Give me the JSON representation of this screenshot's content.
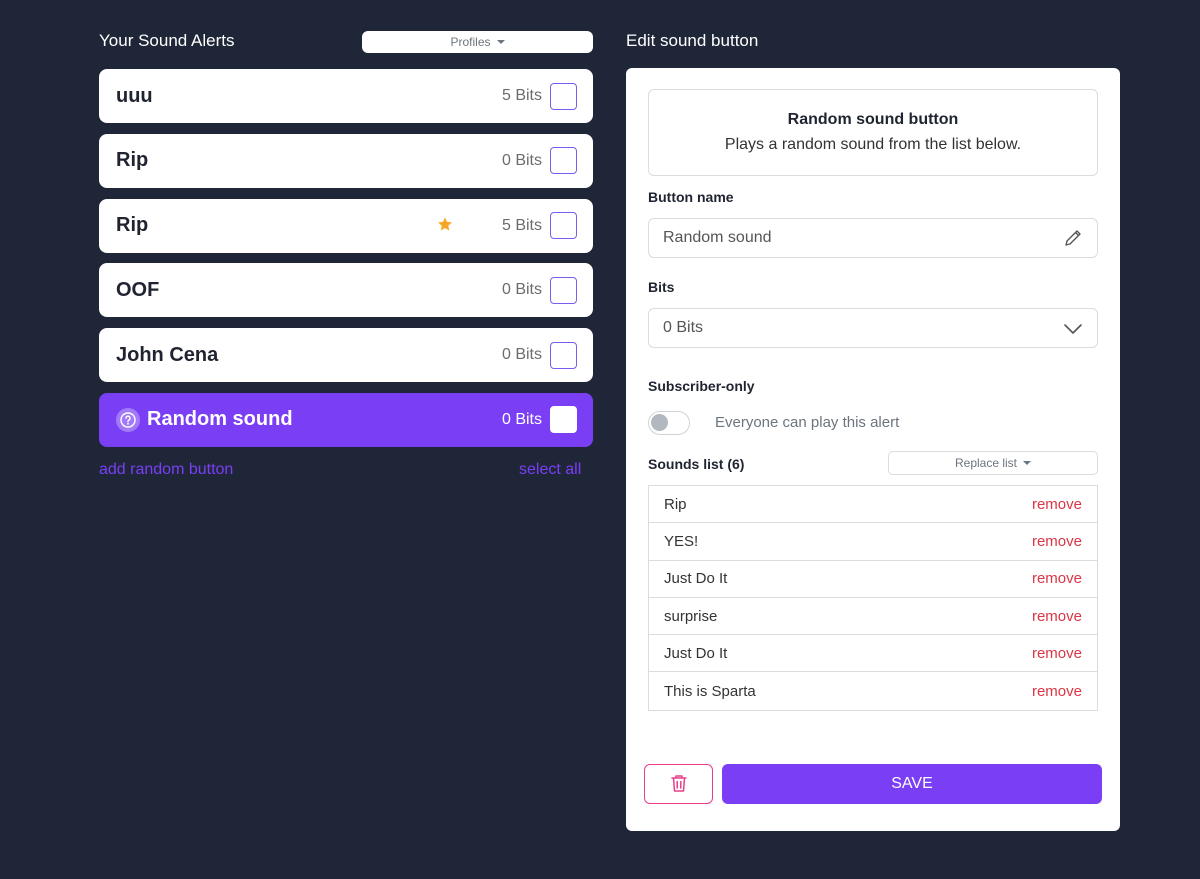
{
  "left": {
    "title": "Your Sound Alerts",
    "profiles_label": "Profiles",
    "alerts": [
      {
        "name": "uuu",
        "bits": "5 Bits",
        "starred": false,
        "active": false
      },
      {
        "name": "Rip",
        "bits": "0 Bits",
        "starred": false,
        "active": false
      },
      {
        "name": "Rip",
        "bits": "5 Bits",
        "starred": true,
        "active": false
      },
      {
        "name": "OOF",
        "bits": "0 Bits",
        "starred": false,
        "active": false
      },
      {
        "name": "John Cena",
        "bits": "0 Bits",
        "starred": false,
        "active": false
      },
      {
        "name": "Random sound",
        "bits": "0 Bits",
        "starred": false,
        "active": true
      }
    ],
    "add_random_label": "add random button",
    "select_all_label": "select all"
  },
  "right": {
    "title": "Edit sound button",
    "info_title": "Random sound button",
    "info_subtitle": "Plays a random sound from the list below.",
    "button_name_label": "Button name",
    "button_name_value": "Random sound",
    "bits_label": "Bits",
    "bits_value": "0 Bits",
    "subscriber_label": "Subscriber-only",
    "subscriber_toggle_text": "Everyone can play this alert",
    "subscriber_only": false,
    "sounds_list_label": "Sounds list (6)",
    "replace_list_label": "Replace list",
    "sounds": [
      {
        "name": "Rip",
        "action": "remove"
      },
      {
        "name": "YES!",
        "action": "remove"
      },
      {
        "name": "Just Do It",
        "action": "remove"
      },
      {
        "name": "surprise",
        "action": "remove"
      },
      {
        "name": "Just Do It",
        "action": "remove"
      },
      {
        "name": "This is Sparta",
        "action": "remove"
      }
    ],
    "save_label": "SAVE"
  },
  "colors": {
    "background": "#1e2638",
    "accent": "#7a3ff5",
    "remove": "#dc3545",
    "star": "#f5a623",
    "delete_border": "#e83e8c"
  },
  "icons": {
    "profiles_caret": "caret-down-icon",
    "star": "star-icon",
    "random": "question-icon",
    "name_edit": "pencil-icon",
    "bits_dropdown": "chevron-down-icon",
    "delete": "trash-icon"
  }
}
